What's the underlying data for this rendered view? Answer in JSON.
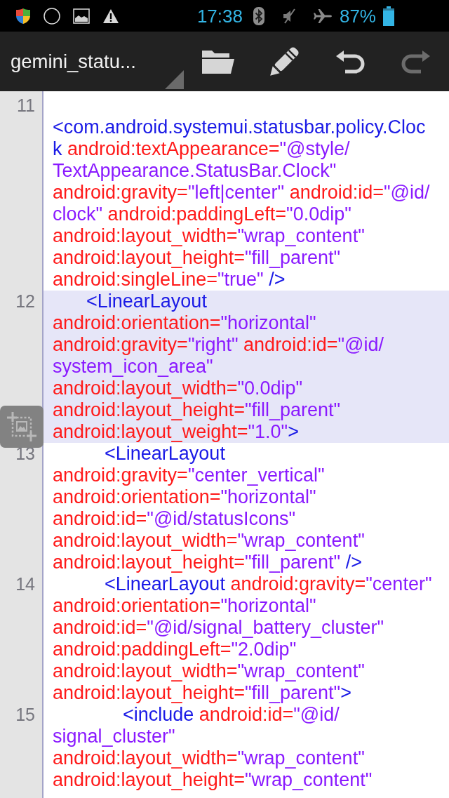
{
  "status_bar": {
    "time": "17:38",
    "battery": "87%"
  },
  "toolbar": {
    "title": "gemini_statu...",
    "actions": [
      {
        "disabled": false
      },
      {
        "disabled": false
      },
      {
        "disabled": false
      },
      {
        "disabled": true
      }
    ]
  },
  "editor": {
    "lines": [
      {
        "number": "11",
        "selected": false,
        "rows": [
          {
            "kind": "blank"
          },
          {
            "kind": "code",
            "segments": [
              {
                "kind": "tag",
                "text": "<com.android.systemui.statusbar.policy.Cloc"
              }
            ]
          },
          {
            "kind": "code",
            "segments": [
              {
                "kind": "tag",
                "text": "k"
              },
              {
                "kind": "attr",
                "text": " android:textAppearance="
              },
              {
                "kind": "value",
                "text": "\"@style/"
              }
            ]
          },
          {
            "kind": "code",
            "segments": [
              {
                "kind": "value",
                "text": "TextAppearance.StatusBar.Clock\""
              }
            ]
          },
          {
            "kind": "code",
            "segments": [
              {
                "kind": "attr",
                "text": "android:gravity="
              },
              {
                "kind": "value",
                "text": "\"left|center\""
              },
              {
                "kind": "attr",
                "text": " android:id="
              },
              {
                "kind": "value",
                "text": "\"@id/"
              }
            ]
          },
          {
            "kind": "code",
            "segments": [
              {
                "kind": "value",
                "text": "clock\""
              },
              {
                "kind": "attr",
                "text": " android:paddingLeft="
              },
              {
                "kind": "value",
                "text": "\"0.0dip\""
              }
            ]
          },
          {
            "kind": "code",
            "segments": [
              {
                "kind": "attr",
                "text": "android:layout_width="
              },
              {
                "kind": "value",
                "text": "\"wrap_content\""
              }
            ]
          },
          {
            "kind": "code",
            "segments": [
              {
                "kind": "attr",
                "text": "android:layout_height="
              },
              {
                "kind": "value",
                "text": "\"fill_parent\""
              }
            ]
          },
          {
            "kind": "code",
            "segments": [
              {
                "kind": "attr",
                "text": "android:singleLine="
              },
              {
                "kind": "value",
                "text": "\"true\""
              },
              {
                "kind": "tag",
                "text": " />"
              }
            ]
          }
        ]
      },
      {
        "number": "12",
        "selected": true,
        "rows": [
          {
            "kind": "code",
            "segments": [
              {
                "kind": "tag",
                "text": "<LinearLayout"
              }
            ]
          },
          {
            "kind": "code",
            "segments": [
              {
                "kind": "attr",
                "text": "android:orientation="
              },
              {
                "kind": "value",
                "text": "\"horizontal\""
              }
            ]
          },
          {
            "kind": "code",
            "segments": [
              {
                "kind": "attr",
                "text": "android:gravity="
              },
              {
                "kind": "value",
                "text": "\"right\""
              },
              {
                "kind": "attr",
                "text": " android:id="
              },
              {
                "kind": "value",
                "text": "\"@id/"
              }
            ]
          },
          {
            "kind": "code",
            "segments": [
              {
                "kind": "value",
                "text": "system_icon_area\""
              }
            ]
          },
          {
            "kind": "code",
            "segments": [
              {
                "kind": "attr",
                "text": "android:layout_width="
              },
              {
                "kind": "value",
                "text": "\"0.0dip\""
              }
            ]
          },
          {
            "kind": "code",
            "segments": [
              {
                "kind": "attr",
                "text": "android:layout_height="
              },
              {
                "kind": "value",
                "text": "\"fill_parent\""
              }
            ]
          },
          {
            "kind": "code",
            "segments": [
              {
                "kind": "attr",
                "text": "android:layout_weight="
              },
              {
                "kind": "value",
                "text": "\"1.0\""
              },
              {
                "kind": "tag",
                "text": ">"
              }
            ]
          }
        ],
        "children": [
          {
            "number": "13",
            "selected": false,
            "rows": [
              {
                "kind": "code",
                "segments": [
                  {
                    "kind": "tag",
                    "text": "<LinearLayout"
                  }
                ]
              },
              {
                "kind": "code",
                "segments": [
                  {
                    "kind": "attr",
                    "text": "android:gravity="
                  },
                  {
                    "kind": "value",
                    "text": "\"center_vertical\""
                  }
                ]
              },
              {
                "kind": "code",
                "segments": [
                  {
                    "kind": "attr",
                    "text": "android:orientation="
                  },
                  {
                    "kind": "value",
                    "text": "\"horizontal\""
                  }
                ]
              },
              {
                "kind": "code",
                "segments": [
                  {
                    "kind": "attr",
                    "text": "android:id="
                  },
                  {
                    "kind": "value",
                    "text": "\"@id/statusIcons\""
                  }
                ]
              },
              {
                "kind": "code",
                "segments": [
                  {
                    "kind": "attr",
                    "text": "android:layout_width="
                  },
                  {
                    "kind": "value",
                    "text": "\"wrap_content\""
                  }
                ]
              },
              {
                "kind": "code",
                "segments": [
                  {
                    "kind": "attr",
                    "text": "android:layout_height="
                  },
                  {
                    "kind": "value",
                    "text": "\"fill_parent\""
                  },
                  {
                    "kind": "tag",
                    "text": " />"
                  }
                ]
              }
            ]
          },
          {
            "number": "14",
            "selected": false,
            "rows": [
              {
                "kind": "code",
                "segments": [
                  {
                    "kind": "tag",
                    "text": "<LinearLayout"
                  },
                  {
                    "kind": "attr",
                    "text": " android:gravity="
                  },
                  {
                    "kind": "value",
                    "text": "\"center\""
                  }
                ]
              },
              {
                "kind": "code",
                "segments": [
                  {
                    "kind": "attr",
                    "text": "android:orientation="
                  },
                  {
                    "kind": "value",
                    "text": "\"horizontal\""
                  }
                ]
              },
              {
                "kind": "code",
                "segments": [
                  {
                    "kind": "attr",
                    "text": "android:id="
                  },
                  {
                    "kind": "value",
                    "text": "\"@id/signal_battery_cluster\""
                  }
                ]
              },
              {
                "kind": "code",
                "segments": [
                  {
                    "kind": "attr",
                    "text": "android:paddingLeft="
                  },
                  {
                    "kind": "value",
                    "text": "\"2.0dip\""
                  }
                ]
              },
              {
                "kind": "code",
                "segments": [
                  {
                    "kind": "attr",
                    "text": "android:layout_width="
                  },
                  {
                    "kind": "value",
                    "text": "\"wrap_content\""
                  }
                ]
              },
              {
                "kind": "code",
                "segments": [
                  {
                    "kind": "attr",
                    "text": "android:layout_height="
                  },
                  {
                    "kind": "value",
                    "text": "\"fill_parent\""
                  },
                  {
                    "kind": "tag",
                    "text": ">"
                  }
                ]
              }
            ],
            "children": [
              {
                "number": "15",
                "selected": false,
                "rows": [
                  {
                    "kind": "code",
                    "segments": [
                      {
                        "kind": "tag",
                        "text": "<include"
                      },
                      {
                        "kind": "attr",
                        "text": " android:id="
                      },
                      {
                        "kind": "value",
                        "text": "\"@id/"
                      }
                    ]
                  },
                  {
                    "kind": "code",
                    "segments": [
                      {
                        "kind": "value",
                        "text": "signal_cluster\""
                      }
                    ]
                  },
                  {
                    "kind": "code",
                    "segments": [
                      {
                        "kind": "attr",
                        "text": "android:layout_width="
                      },
                      {
                        "kind": "value",
                        "text": "\"wrap_content\""
                      }
                    ]
                  },
                  {
                    "kind": "code",
                    "segments": [
                      {
                        "kind": "attr",
                        "text": "android:layout_height="
                      },
                      {
                        "kind": "value",
                        "text": "\"wrap_content\""
                      }
                    ]
                  }
                ]
              }
            ]
          }
        ]
      }
    ]
  }
}
